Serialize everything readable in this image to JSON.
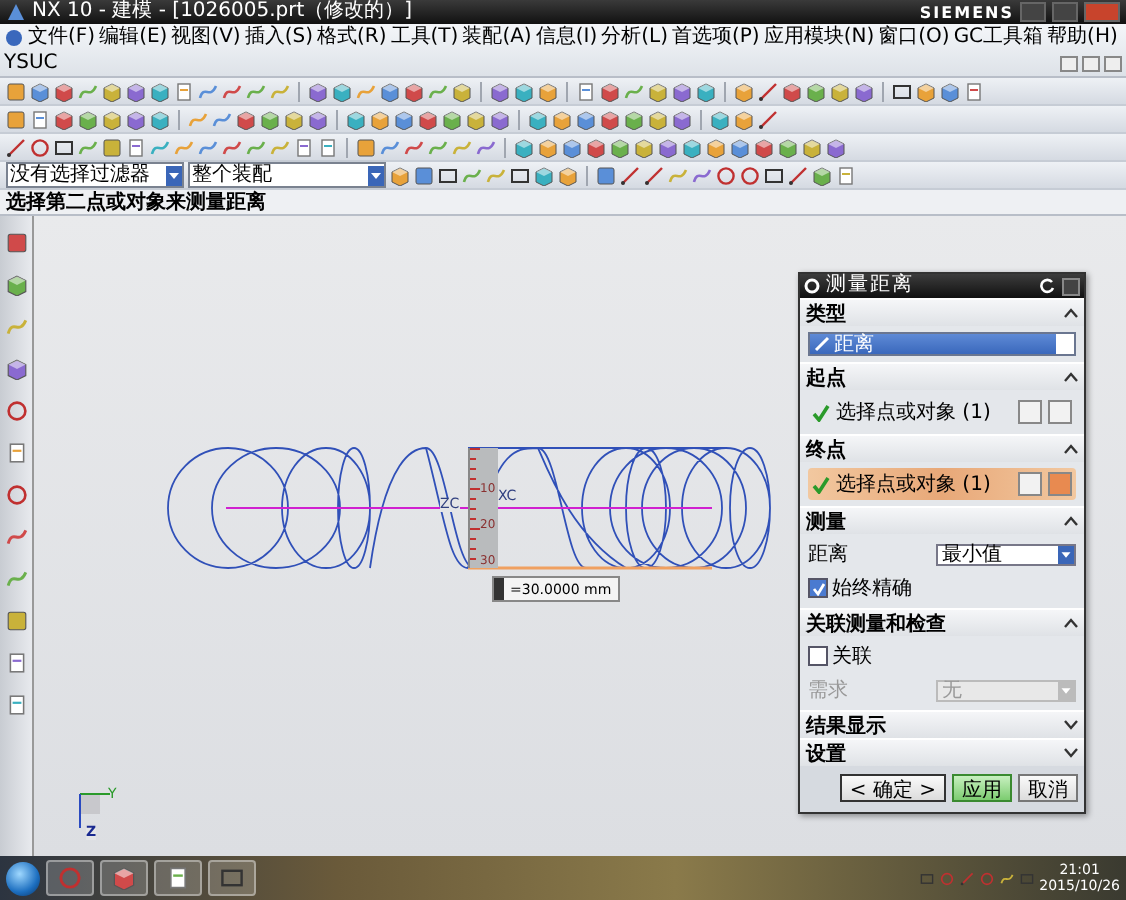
{
  "window": {
    "title": "NX 10 - 建模 - [1026005.prt（修改的）]",
    "brand": "SIEMENS"
  },
  "menu": [
    "文件(F)",
    "编辑(E)",
    "视图(V)",
    "插入(S)",
    "格式(R)",
    "工具(T)",
    "装配(A)",
    "信息(I)",
    "分析(L)",
    "首选项(P)",
    "应用模块(N)",
    "窗口(O)",
    "GC工具箱",
    "帮助(H)",
    "YSUC"
  ],
  "selection_bar": {
    "filter": "没有选择过滤器",
    "scope": "整个装配"
  },
  "status_text": "选择第二点或对象来测量距离",
  "graphics": {
    "ruler_labels": [
      "10",
      "20",
      "30"
    ],
    "axis_labels": [
      "ZC",
      "XC"
    ],
    "measurement": "=30.0000 mm",
    "triad_labels": [
      "Y",
      "Z"
    ]
  },
  "dialog": {
    "title": "测量距离",
    "sections": [
      {
        "kind": "dropdown",
        "title": "类型",
        "expanded": true,
        "value": "距离"
      },
      {
        "kind": "selector",
        "title": "起点",
        "expanded": true,
        "label": "选择点或对象 (1)",
        "complete": true,
        "selected": false
      },
      {
        "kind": "selector",
        "title": "终点",
        "expanded": true,
        "label": "选择点或对象 (1)",
        "complete": true,
        "selected": true
      },
      {
        "kind": "measure",
        "title": "测量",
        "expanded": true,
        "field_label": "距离",
        "value": "最小值",
        "checkbox": {
          "label": "始终精确",
          "checked": true
        }
      },
      {
        "kind": "associative",
        "title": "关联测量和检查",
        "expanded": true,
        "checkbox": {
          "label": "关联",
          "checked": false
        },
        "field_label": "需求",
        "value": "无",
        "disabled": true
      },
      {
        "kind": "collapsed",
        "title": "结果显示",
        "expanded": false
      },
      {
        "kind": "collapsed",
        "title": "设置",
        "expanded": false
      }
    ],
    "buttons": [
      {
        "label": "< 确定 >",
        "kind": "default"
      },
      {
        "label": "应用",
        "kind": "primary"
      },
      {
        "label": "取消",
        "kind": "normal"
      }
    ]
  },
  "taskbar": {
    "time": "21:01",
    "date": "2015/10/26"
  }
}
